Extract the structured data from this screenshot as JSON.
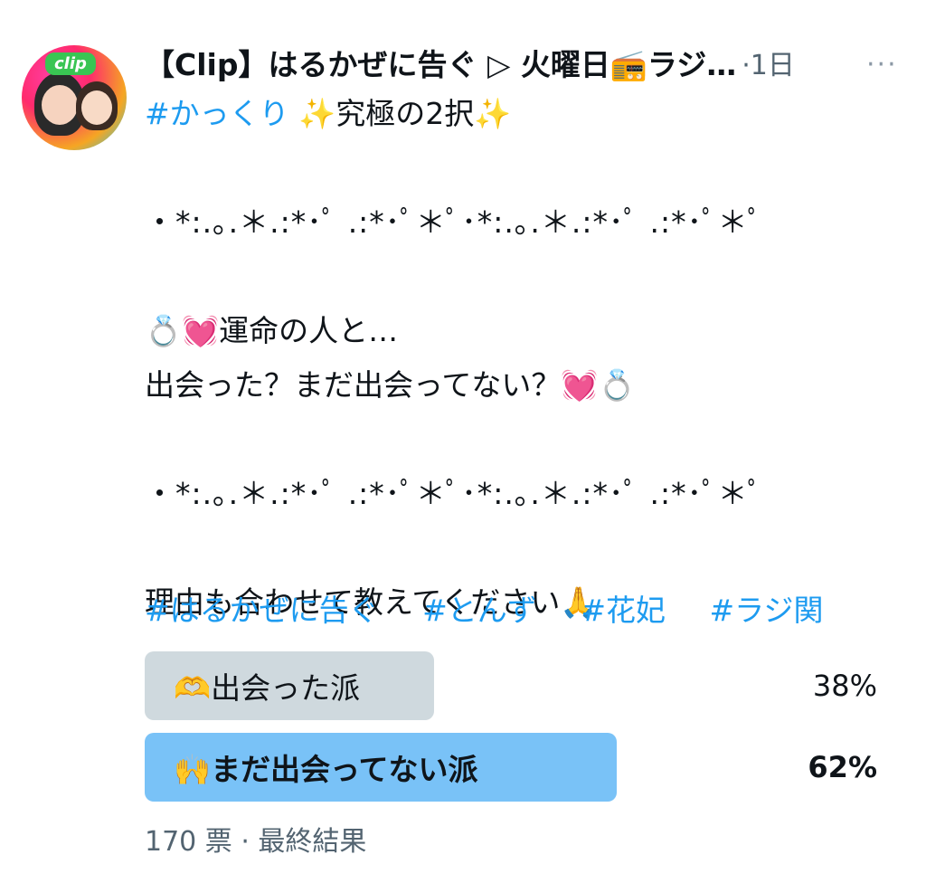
{
  "tweet": {
    "title": "【Clip】はるかぜに告ぐ ▷ 火曜日📻ラジ…",
    "time": "·1日",
    "more_label": "···",
    "avatar_label": "clip",
    "lines": [
      "#かっくり",
      "✨究極の2択✨",
      "・*:.｡.＊.:*･ﾟ .:*･ﾟ＊ﾟ･*:.｡.＊.:*･ﾟ .:*･ﾟ＊ﾟ",
      "💍💓運命の人と…",
      "出会った？まだ出会ってない？💓💍",
      "・*:.｡.＊.:*･ﾟ .:*･ﾟ＊ﾟ･*:.｡.＊.:*･ﾟ .:*･ﾟ＊ﾟ",
      "理由も合わせて教えてください🙏"
    ],
    "hashtags": [
      "#はるかぜに告ぐ",
      "#とんず",
      "#花妃",
      "#ラジ関"
    ]
  },
  "poll": {
    "options": [
      {
        "label": "🫶出会った派",
        "percent_text": "38%",
        "percent": 38,
        "winner": false
      },
      {
        "label": "🙌まだ出会ってない派",
        "percent_text": "62%",
        "percent": 62,
        "winner": true
      }
    ],
    "votes": "170 票",
    "status": "最終結果"
  },
  "colors": {
    "hashtag": "#1d9bf0",
    "winner_bar": "#79c2f7",
    "loser_bar": "#cfd9de",
    "muted_text": "#536471"
  }
}
